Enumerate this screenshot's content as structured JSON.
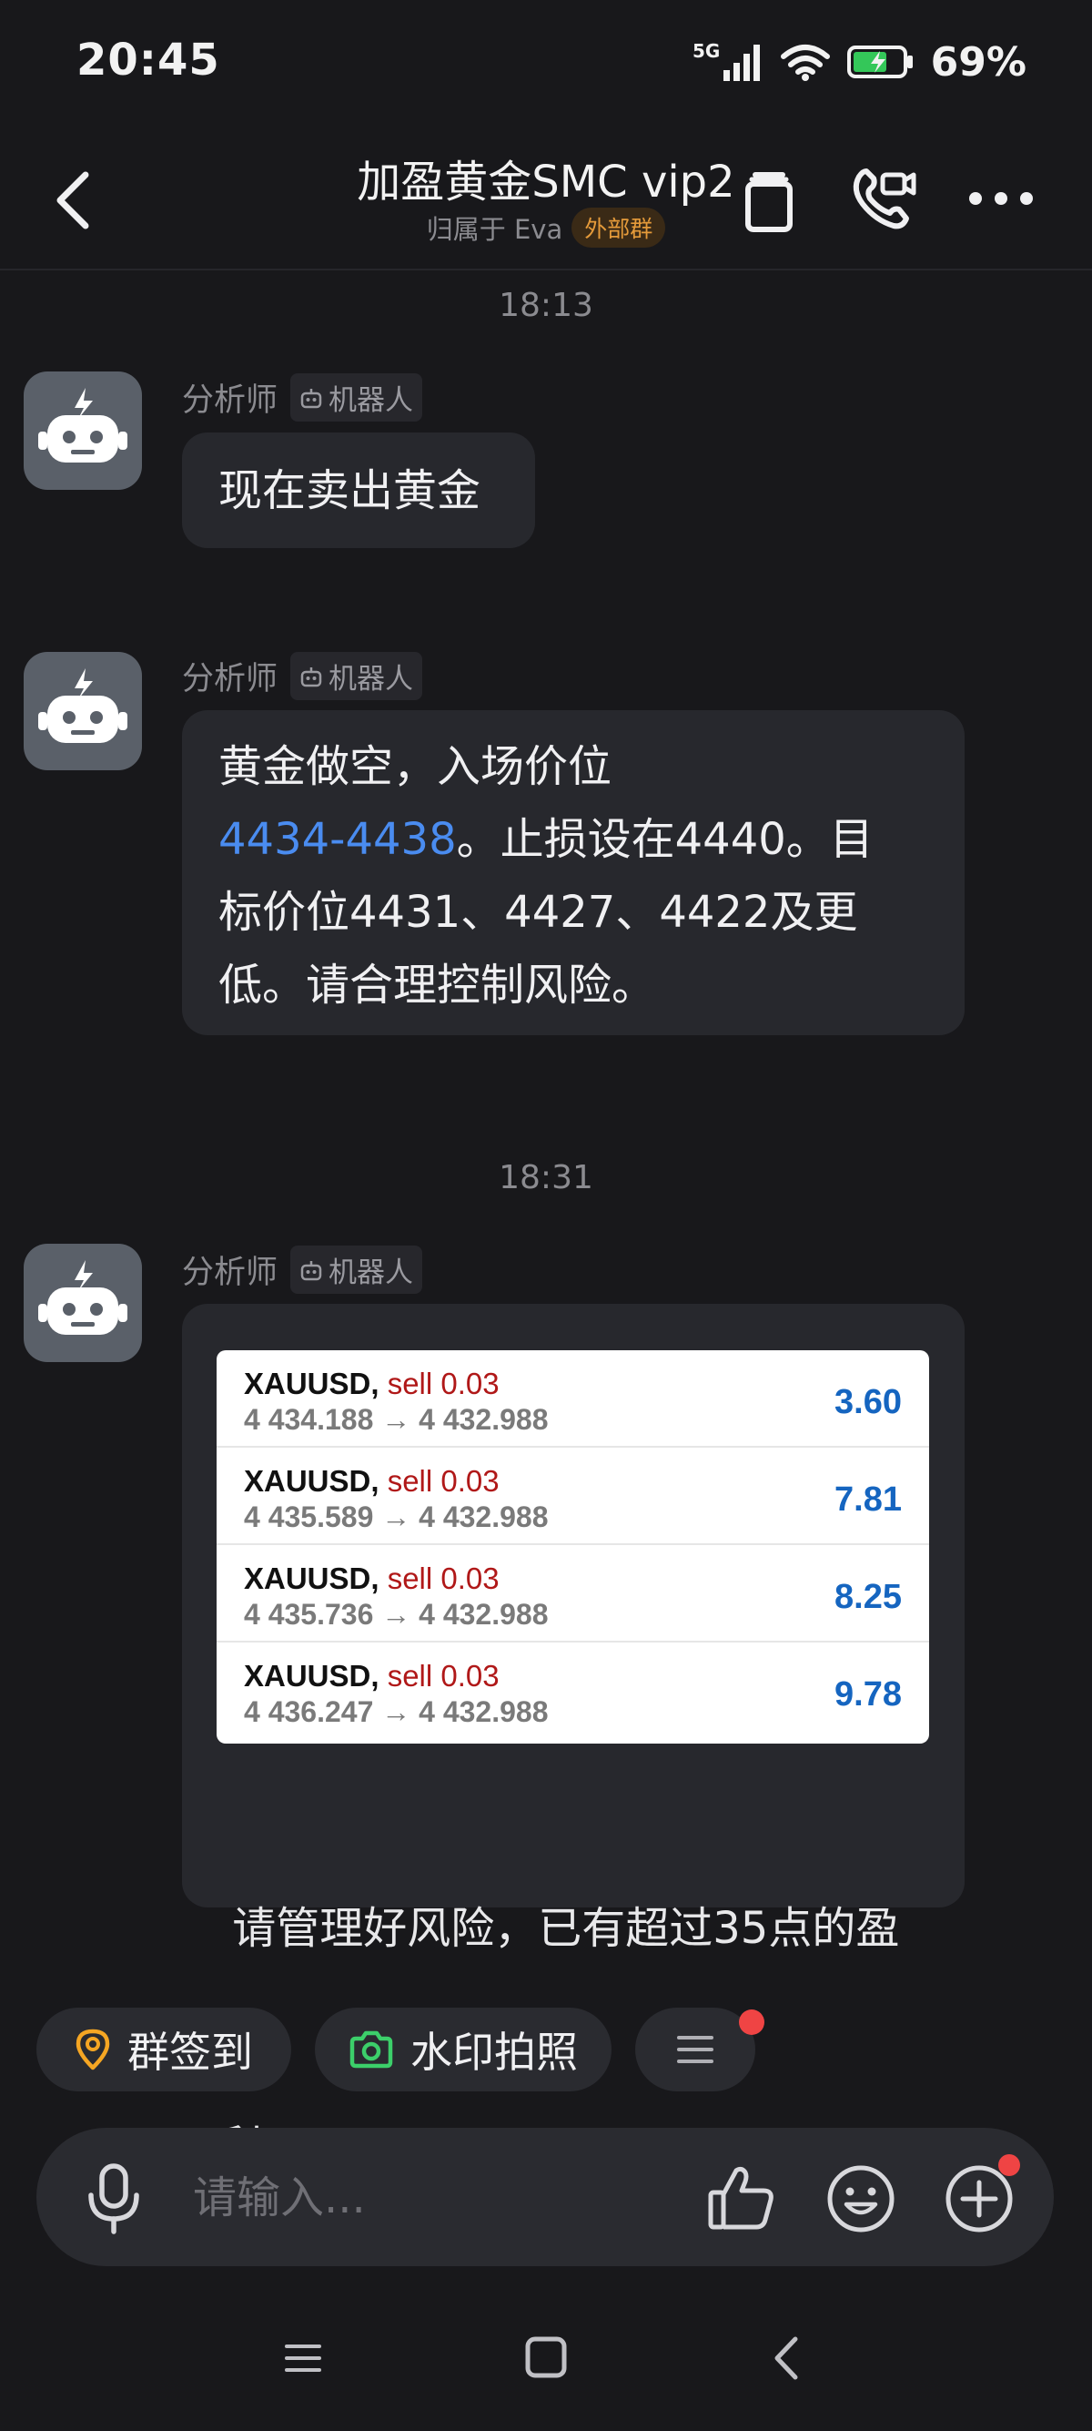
{
  "status_bar": {
    "time": "20:45",
    "network": "5G",
    "battery": "69%"
  },
  "header": {
    "title": "加盈黄金SMC vip2",
    "owner": "归属于 Eva",
    "tag": "外部群"
  },
  "messages": [
    {
      "timestamp": "18:13",
      "sender": "分析师",
      "bot_tag": "机器人",
      "text": "现在卖出黄金"
    },
    {
      "sender": "分析师",
      "bot_tag": "机器人",
      "text_line1": "黄金做空，入场价位",
      "link": "4434-4438",
      "text_after_link": "。止损设在4440。目",
      "text_line3": "标价位4431、4427、4422及更",
      "text_line4": "低。请合理控制风险。"
    },
    {
      "timestamp": "18:31",
      "sender": "分析师",
      "bot_tag": "机器人",
      "trades": [
        {
          "symbol": "XAUUSD,",
          "side": "sell 0.03",
          "prices": "4 434.188 → 4 432.988",
          "profit": "3.60"
        },
        {
          "symbol": "XAUUSD,",
          "side": "sell 0.03",
          "prices": "4 435.589 → 4 432.988",
          "profit": "7.81"
        },
        {
          "symbol": "XAUUSD,",
          "side": "sell 0.03",
          "prices": "4 435.736 → 4 432.988",
          "profit": "8.25"
        },
        {
          "symbol": "XAUUSD,",
          "side": "sell 0.03",
          "prices": "4 436.247 → 4 432.988",
          "profit": "9.78"
        }
      ],
      "caption_line1": " 请管理好风险，已有超过35点的盈",
      "caption_line2": "利。"
    }
  ],
  "quick_actions": {
    "checkin": "群签到",
    "watermark_photo": "水印拍照"
  },
  "input": {
    "placeholder": "请输入..."
  },
  "colors": {
    "background": "#18181b",
    "bubble": "#27282d",
    "link": "#4a8cf0",
    "tag": "#e49a3a",
    "sell": "#b01818",
    "profit": "#1565c0",
    "notification": "#ef4444"
  }
}
